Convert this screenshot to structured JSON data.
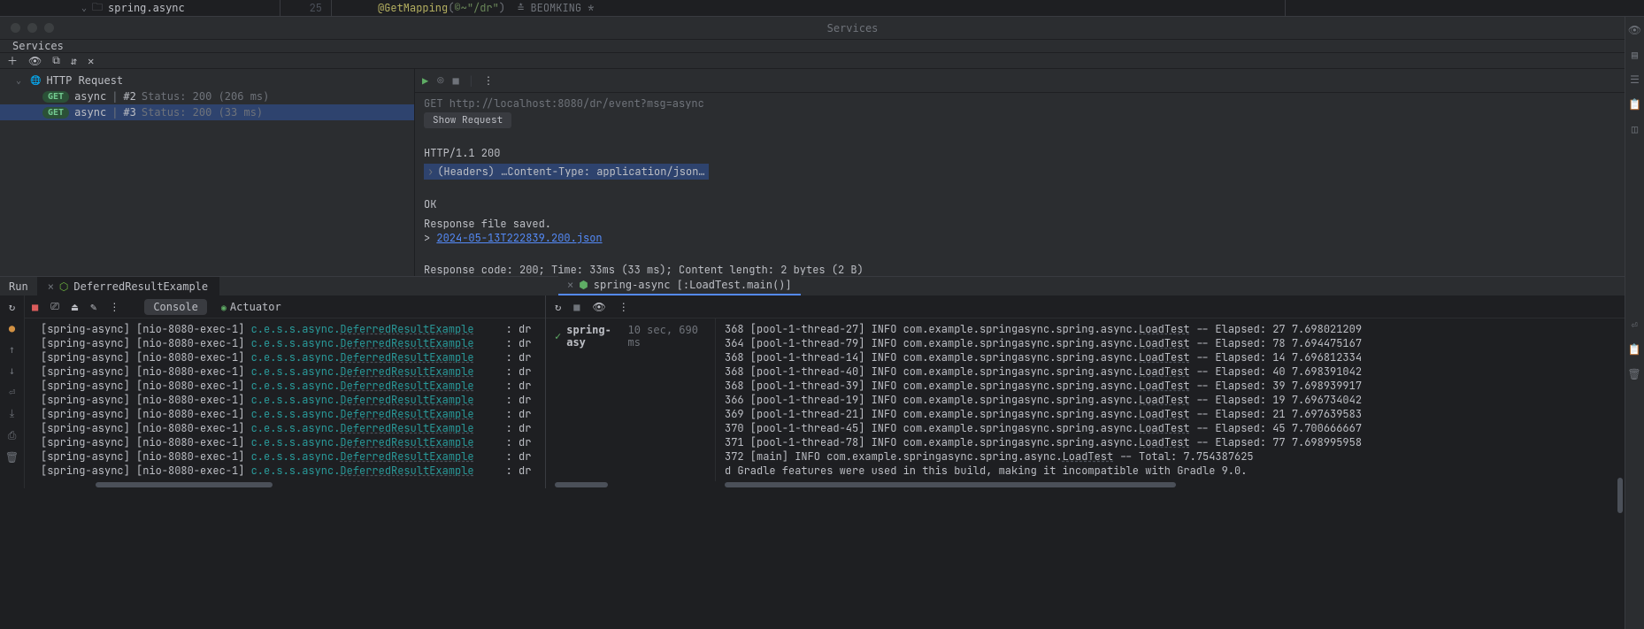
{
  "editor": {
    "folder": "spring.async",
    "line_number": "25",
    "annotation": "@GetMapping",
    "paren_open": "(",
    "clover_prefix": "©~",
    "path": "\"/dr\"",
    "paren_close": ")",
    "author": "≛ BEOMKING *"
  },
  "services": {
    "window_title": "Services",
    "header": "Services",
    "tree": {
      "root": "HTTP Request",
      "items": [
        {
          "method": "GET",
          "name": "async",
          "idx": "#2",
          "status": "Status: 200 (206 ms)"
        },
        {
          "method": "GET",
          "name": "async",
          "idx": "#3",
          "status": "Status: 200 (33 ms)"
        }
      ]
    },
    "detail": {
      "request_line": "GET http://localhost:8080/dr/event?msg=async",
      "show_request": "Show Request",
      "status_line": "HTTP/1.1 200",
      "headers_summary": "(Headers) …Content-Type: application/json…",
      "body": "OK",
      "file_saved": "Response file saved.",
      "file_link": "2024-05-13T222839.200.json",
      "summary": "Response code: 200; Time: 33ms (33 ms); Content length: 2 bytes (2 B)"
    }
  },
  "run": {
    "label": "Run",
    "tabs": [
      {
        "name": "DeferredResultExample"
      },
      {
        "name": "spring-async [:LoadTest.main()]"
      }
    ],
    "subtabs": {
      "console": "Console",
      "actuator": "Actuator"
    },
    "console_lines": [
      "[spring-async] [nio-8080-exec-1] c.e.s.s.async.DeferredResultExample     : dr",
      "[spring-async] [nio-8080-exec-1] c.e.s.s.async.DeferredResultExample     : dr",
      "[spring-async] [nio-8080-exec-1] c.e.s.s.async.DeferredResultExample     : dr",
      "[spring-async] [nio-8080-exec-1] c.e.s.s.async.DeferredResultExample     : dr",
      "[spring-async] [nio-8080-exec-1] c.e.s.s.async.DeferredResultExample     : dr",
      "[spring-async] [nio-8080-exec-1] c.e.s.s.async.DeferredResultExample     : dr",
      "[spring-async] [nio-8080-exec-1] c.e.s.s.async.DeferredResultExample     : dr",
      "[spring-async] [nio-8080-exec-1] c.e.s.s.async.DeferredResultExample     : dr",
      "[spring-async] [nio-8080-exec-1] c.e.s.s.async.DeferredResultExample     : dr",
      "[spring-async] [nio-8080-exec-1] c.e.s.s.async.DeferredResultExample     : dr",
      "[spring-async] [nio-8080-exec-1] c.e.s.s.async.DeferredResultExample     : dr"
    ],
    "test_tree": {
      "name": "spring-asy",
      "time": "10 sec, 690 ms"
    },
    "loadtest_lines": [
      "368 [pool-1-thread-27] INFO com.example.springasync.spring.async.LoadTest -- Elapsed: 27 7.698021209",
      "364 [pool-1-thread-79] INFO com.example.springasync.spring.async.LoadTest -- Elapsed: 78 7.694475167",
      "368 [pool-1-thread-14] INFO com.example.springasync.spring.async.LoadTest -- Elapsed: 14 7.696812334",
      "368 [pool-1-thread-40] INFO com.example.springasync.spring.async.LoadTest -- Elapsed: 40 7.698391042",
      "368 [pool-1-thread-39] INFO com.example.springasync.spring.async.LoadTest -- Elapsed: 39 7.698939917",
      "366 [pool-1-thread-19] INFO com.example.springasync.spring.async.LoadTest -- Elapsed: 19 7.696734042",
      "369 [pool-1-thread-21] INFO com.example.springasync.spring.async.LoadTest -- Elapsed: 21 7.697639583",
      "370 [pool-1-thread-45] INFO com.example.springasync.spring.async.LoadTest -- Elapsed: 45 7.700666667",
      "371 [pool-1-thread-78] INFO com.example.springasync.spring.async.LoadTest -- Elapsed: 77 7.698995958",
      "372 [main] INFO com.example.springasync.spring.async.LoadTest -- Total: 7.754387625",
      "",
      "d Gradle features were used in this build, making it incompatible with Gradle 9.0."
    ]
  }
}
